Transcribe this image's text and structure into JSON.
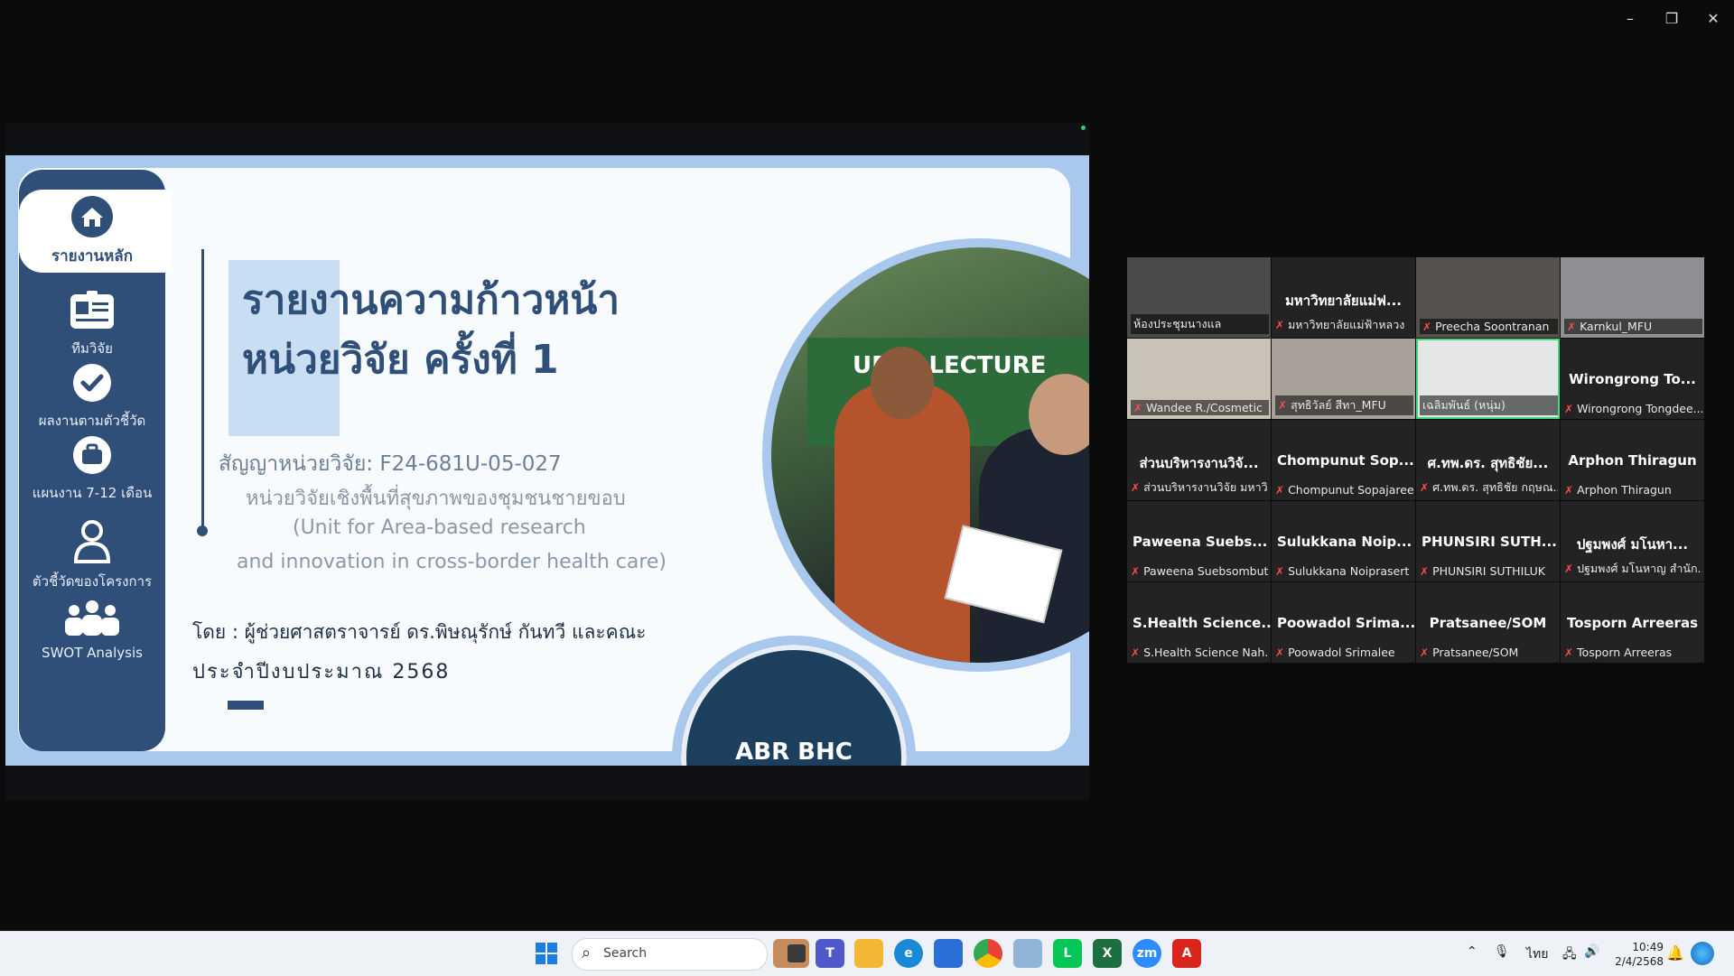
{
  "window": {
    "minimize": "–",
    "restore": "❐",
    "close": "✕"
  },
  "slide": {
    "nav": [
      {
        "label": "รายงานหลัก",
        "icon": "home-icon"
      },
      {
        "label": "ทีมวิจัย",
        "icon": "id-card-icon"
      },
      {
        "label": "ผลงานตามตัวชี้วัด",
        "icon": "check-circle-icon"
      },
      {
        "label": "แผนงาน 7-12 เดือน",
        "icon": "briefcase-icon"
      },
      {
        "label": "ตัวชี้วัดของโครงการ",
        "icon": "user-icon"
      },
      {
        "label": "SWOT Analysis",
        "icon": "team-icon"
      }
    ],
    "title_line1": "รายงานความก้าวหน้า",
    "title_line2": "หน่วยวิจัย ครั้งที่ 1",
    "contract": "สัญญาหน่วยวิจัย: F24-681U-05-027",
    "unit_th": "หน่วยวิจัยเชิงพื้นที่สุขภาพของชุมชนชายขอบ",
    "unit_en1": "(Unit for Area-based research",
    "unit_en2": "and innovation in cross-border health care)",
    "byline": "โดย : ผู้ช่วยศาสตราจารย์ ดร.พิษณุรักษ์ กันทวี และคณะ",
    "fiscal_year": "ประจำปีงบประมาณ 2568",
    "photo_banner": "UEST LECTURE",
    "logo_text": "ABR BHC"
  },
  "participants": [
    {
      "display": "",
      "label": "ห้องประชุมนางแล",
      "muted": false,
      "video": true
    },
    {
      "display": "มหาวิทยาลัยแม่ฟ...",
      "label": "มหาวิทยาลัยแม่ฟ้าหลวง",
      "muted": true,
      "video": false
    },
    {
      "display": "",
      "label": "Preecha Soontranan",
      "muted": true,
      "video": true
    },
    {
      "display": "",
      "label": "Karnkul_MFU",
      "muted": true,
      "video": true
    },
    {
      "display": "",
      "label": "Wandee R./Cosmetic",
      "muted": true,
      "video": true
    },
    {
      "display": "",
      "label": "สุทธิวัลย์ สีทา_MFU",
      "muted": true,
      "video": true
    },
    {
      "display": "",
      "label": "เฉลิมพันธ์ (หนุ่ม)",
      "muted": false,
      "video": true
    },
    {
      "display": "Wirongrong To...",
      "label": "Wirongrong Tongdee...",
      "muted": true,
      "video": false
    },
    {
      "display": "ส่วนบริหารงานวิจั...",
      "label": "ส่วนบริหารงานวิจัย มหาวิ...",
      "muted": true,
      "video": false
    },
    {
      "display": "Chompunut Sop...",
      "label": "Chompunut Sopajaree",
      "muted": true,
      "video": false
    },
    {
      "display": "ศ.ทพ.ดร. สุทธิชัย...",
      "label": "ศ.ทพ.ดร. สุทธิชัย กฤษณ...",
      "muted": true,
      "video": false
    },
    {
      "display": "Arphon Thiragun",
      "label": "Arphon Thiragun",
      "muted": true,
      "video": false
    },
    {
      "display": "Paweena Suebs...",
      "label": "Paweena Suebsombut",
      "muted": true,
      "video": false
    },
    {
      "display": "Sulukkana Noip...",
      "label": "Sulukkana Noiprasert",
      "muted": true,
      "video": false
    },
    {
      "display": "PHUNSIRI SUTH...",
      "label": "PHUNSIRI SUTHILUK",
      "muted": true,
      "video": false
    },
    {
      "display": "ปฐมพงศ์ มโนหา...",
      "label": "ปฐมพงศ์ มโนหาญ สำนัก...",
      "muted": true,
      "video": false
    },
    {
      "display": "S.Health Science...",
      "label": "S.Health Science Nah...",
      "muted": true,
      "video": false
    },
    {
      "display": "Poowadol Srima...",
      "label": "Poowadol Srimalee",
      "muted": true,
      "video": false
    },
    {
      "display": "Pratsanee/SOM",
      "label": "Pratsanee/SOM",
      "muted": true,
      "video": false
    },
    {
      "display": "Tosporn Arreeras",
      "label": "Tosporn Arreeras",
      "muted": true,
      "video": false
    }
  ],
  "taskbar": {
    "search_placeholder": "Search",
    "apps": [
      "file-explorer",
      "teams",
      "folder",
      "edge",
      "store",
      "chrome",
      "gallery",
      "line",
      "excel",
      "zoom",
      "acrobat"
    ],
    "tray": {
      "chevron": "⌃",
      "mic": "🎙",
      "lang": "ไทย",
      "network": "🖧",
      "volume": "🔊"
    },
    "time": "10:49",
    "date": "2/4/2568"
  },
  "colors": {
    "slide_navy": "#2f4f78",
    "slide_frame": "#a9c8ee",
    "active_speaker": "#3ddc84",
    "muted_mic": "#ff4d4d"
  }
}
